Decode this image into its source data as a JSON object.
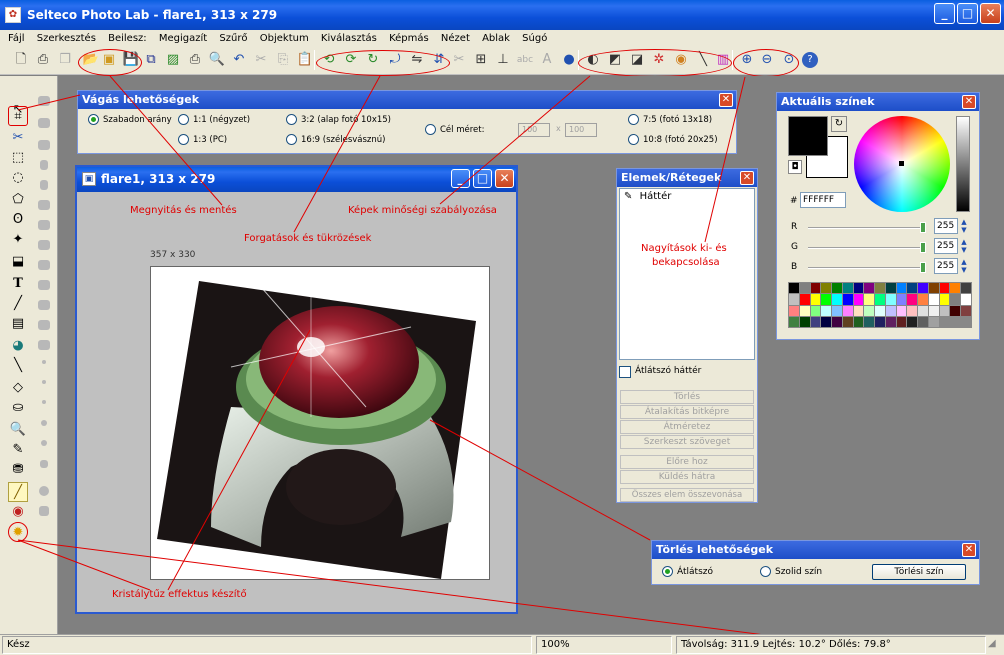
{
  "app": {
    "title": "Selteco Photo Lab - flare1, 313 x 279"
  },
  "menu": [
    "Fájl",
    "Szerkesztés",
    "Beilesz:",
    "Megigazít",
    "Szűrő",
    "Objektum",
    "Kiválasztás",
    "Képmás",
    "Nézet",
    "Ablak",
    "Súgó"
  ],
  "crop": {
    "title": "Vágás lehetőségek",
    "options": [
      "Szabadon arány",
      "1:1 (négyzet)",
      "1:3 (PC)",
      "3:2 (alap fotó 10x15)",
      "16:9 (szélesvásznú)",
      "Cél méret:",
      "7:5 (fotó 13x18)",
      "10:8 (fotó 20x25)"
    ],
    "width_value": "100",
    "x_label": "x",
    "height_value": "100"
  },
  "image_window": {
    "title": "flare1, 313 x 279",
    "size_label": "357 x 330"
  },
  "layers": {
    "title": "Elemek/Rétegek",
    "items": [
      "Háttér"
    ],
    "transparent_label": "Átlátszó háttér",
    "buttons": [
      "Törlés",
      "Átalakítás bitképre",
      "Átméretez",
      "Szerkeszt szöveget",
      "Előre hoz",
      "Küldés hátra",
      "Összes elem összevonása"
    ]
  },
  "colors": {
    "title": "Aktuális színek",
    "hex_label": "#",
    "hex_value": "FFFFFF",
    "channels": [
      {
        "label": "R",
        "value": "255"
      },
      {
        "label": "G",
        "value": "255"
      },
      {
        "label": "B",
        "value": "255"
      }
    ],
    "palette": [
      "#000000",
      "#808080",
      "#800000",
      "#808000",
      "#008000",
      "#008080",
      "#000080",
      "#800080",
      "#808040",
      "#004040",
      "#0080ff",
      "#004080",
      "#4000ff",
      "#804000",
      "#ff0000",
      "#ff8000",
      "#404040",
      "#c0c0c0",
      "#ff0000",
      "#ffff00",
      "#00ff00",
      "#00ffff",
      "#0000ff",
      "#ff00ff",
      "#ffff80",
      "#00ff80",
      "#80ffff",
      "#8080ff",
      "#ff0080",
      "#ff8040",
      "#ffffff",
      "#ffff00",
      "#808080",
      "#ffffff",
      "#ff8080",
      "#ffffc0",
      "#80ff80",
      "#c0ffff",
      "#80c0ff",
      "#ff80ff",
      "#ffe0c0",
      "#c0ffc0",
      "#e0ffff",
      "#c0c0ff",
      "#ffc0ff",
      "#ffc0c0",
      "#e0e0e0",
      "#f0f0f0",
      "#c0c0c0",
      "#400000",
      "#804040",
      "#408040",
      "#004000",
      "#404080",
      "#000040",
      "#400040",
      "#604020",
      "#206020",
      "#206060",
      "#202060",
      "#602060",
      "#602020",
      "#202020",
      "#606060",
      "#a0a0a0"
    ]
  },
  "erase": {
    "title": "Törlés lehetőségek",
    "option1": "Átlátszó",
    "option2": "Szolid szín",
    "button": "Törlési szín"
  },
  "status": {
    "ready": "Kész",
    "zoom": "100%",
    "info": "Távolság: 311.9  Lejtés: 10.2°  Dőlés: 79.8°"
  },
  "annotations": {
    "open_save": "Megnyitás és mentés",
    "rotate": "Forgatások és tükrözések",
    "quality": "Képek minőségi szabályozása",
    "zoom_1": "Nagyítások ki- és",
    "zoom_2": "bekapcsolása",
    "crystal": "Kristálytűz effektus készítő"
  },
  "accent": "#e00000"
}
